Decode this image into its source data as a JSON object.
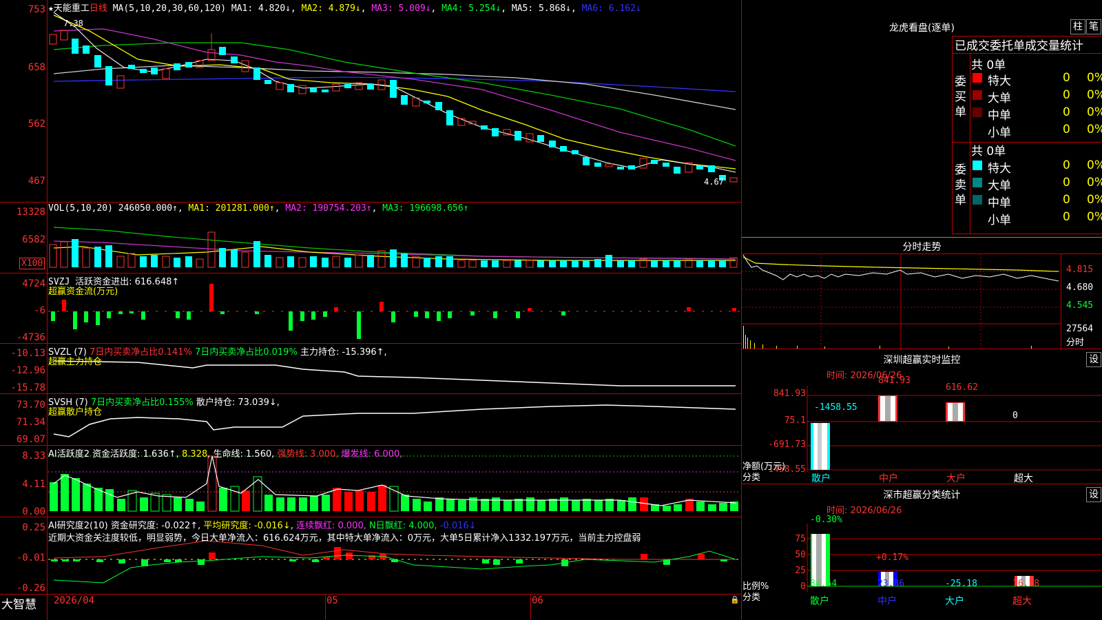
{
  "stock": {
    "name": "天能重工",
    "period": "日线",
    "ma_label": "MA(5,10,20,30,60,120)",
    "ma1": "MA1: 4.820↓",
    "ma2": "MA2: 4.879↓",
    "ma3": "MA3: 5.009↓",
    "ma4": "MA4: 5.254↓",
    "ma5": "MA5: 5.868↓",
    "ma6": "MA6: 6.162↓",
    "high_mark": "7.38",
    "low_mark": "4.67",
    "price_axis": [
      "753",
      "658",
      "562",
      "467"
    ]
  },
  "volume": {
    "label": "VOL(5,10,20)",
    "value": "246050.000↑",
    "ma1": "MA1: 201281.000↑",
    "ma2": "MA2: 190754.203↑",
    "ma3": "MA3: 196698.656↑",
    "axis": [
      "13328",
      "6582"
    ],
    "unit": "X100"
  },
  "svzj": {
    "label": "SVZJ",
    "desc": "活跃资金进出: 616.648↑",
    "sub": "超赢资金流(万元)",
    "axis": [
      "4724",
      "-6",
      "-4736"
    ]
  },
  "svzl": {
    "label": "SVZL (7)",
    "buy_ratio": "7日内买卖净占比0.141%",
    "net_ratio": "7日内买卖净占比0.019%",
    "holding": "主力持仓: -15.396↑,",
    "sub": "超赢主力持仓",
    "axis": [
      "-10.13",
      "-12.96",
      "-15.78"
    ]
  },
  "svsh": {
    "label": "SVSH (7)",
    "ratio": "7日内买卖净占比0.155%",
    "holding": "散户持仓: 73.039↓,",
    "sub": "超赢散户持仓",
    "axis": [
      "73.70",
      "71.34",
      "69.07"
    ]
  },
  "ai_active": {
    "label": "AI活跃度2",
    "activity": "资金活跃度: 1.636↑",
    "value2": "8.328",
    "life": "生命线: 1.560,",
    "strong": "强势线: 3.000,",
    "burst": "爆发线: 6.000,",
    "axis": [
      "8.33",
      "4.11",
      "0.00"
    ]
  },
  "ai_research": {
    "label": "AI研究度2(10)",
    "research": "资金研究度: -0.022↑",
    "avg": "平均研究度: -0.016↓",
    "cont": "连续飘红: 0.000,",
    "ndays": "N日飘红: 4.000,",
    "last": "-0.016↓",
    "comment": "近期大资金关注度较低，明显弱势，今日大单净流入：616.624万元，其中特大单净流入：0万元，大单5日累计净入1332.197万元，当前主力控盘弱",
    "axis": [
      "0.25",
      "-0.01",
      "-0.26"
    ]
  },
  "xaxis": {
    "brand": "大智慧",
    "d1": "2026/04",
    "d2": "05",
    "d3": "06"
  },
  "panel_dragon": {
    "title": "龙虎看盘(逐单)",
    "btn1": "柱",
    "btn2": "笔",
    "header": "已成交委托单成交量统计",
    "buy_side": "委买单",
    "sell_side": "委卖单",
    "buy_total": "共 0单",
    "sell_total": "共 0单",
    "buy_rows": [
      {
        "name": "特大",
        "count": "0",
        "pct": "0%"
      },
      {
        "name": "大单",
        "count": "0",
        "pct": "0%"
      },
      {
        "name": "中单",
        "count": "0",
        "pct": "0%"
      },
      {
        "name": "小单",
        "count": "0",
        "pct": "0%"
      }
    ],
    "sell_rows": [
      {
        "name": "特大",
        "count": "0",
        "pct": "0%"
      },
      {
        "name": "大单",
        "count": "0",
        "pct": "0%"
      },
      {
        "name": "中单",
        "count": "0",
        "pct": "0%"
      },
      {
        "name": "小单",
        "count": "0",
        "pct": "0%"
      }
    ]
  },
  "panel_intraday": {
    "title": "分时走势",
    "axis": [
      "4.815",
      "4.680",
      "4.545"
    ],
    "vol": "27564",
    "vol_label": "分时"
  },
  "panel_sz_monitor": {
    "title": "深圳超赢实时监控",
    "btn": "设",
    "time": "时间: 2026/06/26",
    "axis": [
      "841.93",
      "75.1",
      "-691.73",
      "-1458.55"
    ],
    "unit": "净额(万元)",
    "category_label": "分类",
    "categories": [
      "散户",
      "中户",
      "大户",
      "超大"
    ],
    "values": [
      "-1458.55",
      "841.93",
      "616.62",
      "0"
    ]
  },
  "panel_sz_class": {
    "title": "深市超赢分类统计",
    "btn": "设",
    "time": "时间: 2026/06/26",
    "axis": [
      "75",
      "50",
      "25",
      "0"
    ],
    "unit": "比例%",
    "category_label": "分类",
    "categories": [
      "散户",
      "中户",
      "大户",
      "超大"
    ],
    "top_labels": [
      "-0.30%",
      "+0.17%"
    ],
    "bottom_values": [
      "84.54",
      "23.86",
      "-25.18",
      "16.78"
    ]
  }
}
